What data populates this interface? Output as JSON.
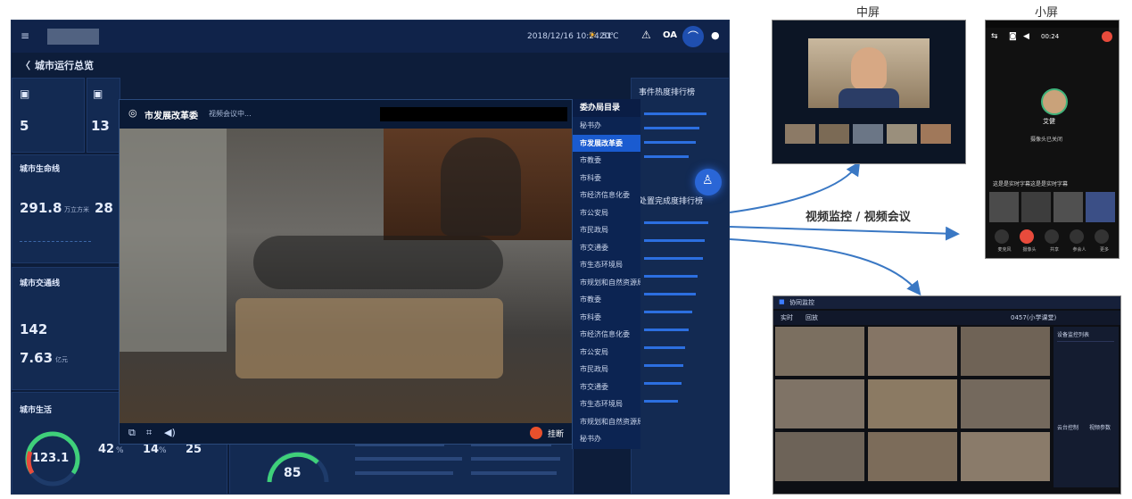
{
  "header": {
    "datetime": "2018/12/16 10:24:51",
    "weather": "20℃",
    "oa_label": "OA"
  },
  "breadcrumb": {
    "title": "城市运行总览"
  },
  "left_stats": {
    "card1_value": "5",
    "card2_value": "13",
    "section1_title": "城市生命线",
    "stat1_value": "291.8",
    "stat1_suffix": "万立方米",
    "stat2_value": "28",
    "section2_title": "城市交通线",
    "stat3_value": "142",
    "stat4_value": "7.63",
    "stat4_suffix": "亿元",
    "section3_title": "城市生活",
    "gauge_value": "123.1",
    "pct1": "42",
    "pct1_unit": "%",
    "pct2": "14",
    "pct2_unit": "%",
    "pct3": "25",
    "bottom_gauge": "85"
  },
  "video": {
    "caller": "市发展改革委",
    "status": "视频会议中...",
    "hangup_label": "挂断"
  },
  "directory": {
    "title": "委办局目录",
    "items": [
      "秘书办",
      "市发展改革委",
      "市教委",
      "市科委",
      "市经济信息化委",
      "市公安局",
      "市民政局",
      "市交通委",
      "市生态环境局",
      "市规划和自然资源局",
      "市教委",
      "市科委",
      "市经济信息化委",
      "市公安局",
      "市民政局",
      "市交通委",
      "市生态环境局",
      "市规划和自然资源局",
      "秘书办"
    ],
    "active_index": 1
  },
  "right_panel": {
    "ranking_title": "事件热度排行榜",
    "ranking2_title": "处置完成度排行榜"
  },
  "captions": {
    "mid_screen": "中屏",
    "small_screen": "小屏",
    "arrow_label": "视频监控 / 视频会议"
  },
  "phone": {
    "time": "00:24",
    "contact": "艾健",
    "camera_off": "摄像头已关闭",
    "subtitle_prompt": "这是是实时字幕这是是实时字幕",
    "controls": [
      "麦克风",
      "摄像头",
      "共享",
      "参会人",
      "更多"
    ]
  },
  "surveillance": {
    "title": "协同监控",
    "tab1": "实时",
    "tab2": "回放",
    "camera_id": "0457(小学课堂)",
    "panel_title": "设备监控列表",
    "btn1": "云台控制",
    "btn2": "视频参数"
  },
  "colors": {
    "dashboard_bg": "#0d1d3a",
    "accent": "#1a5bd0",
    "hangup": "#e8502c",
    "arrow": "#3a78c4"
  }
}
